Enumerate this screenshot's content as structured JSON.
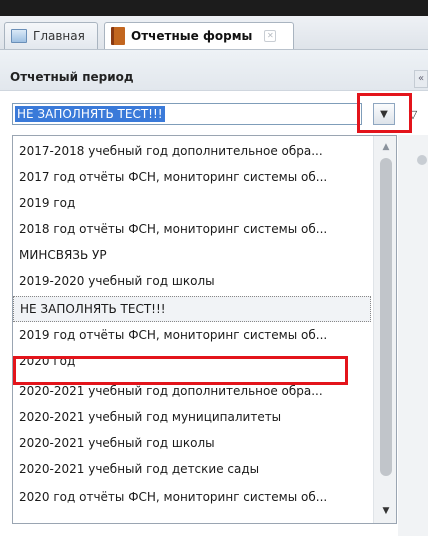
{
  "tabs": [
    {
      "label": "Главная",
      "icon": "home-icon"
    },
    {
      "label": "Отчетные формы",
      "icon": "book-icon",
      "close": "✕"
    }
  ],
  "panel": {
    "title": "Отчетный период",
    "collapse": "«"
  },
  "combo": {
    "value": "НЕ ЗАПОЛНЯТЬ ТЕСТ!!!",
    "trigger_glyph": "▼",
    "filter_glyph": "▽"
  },
  "dropdown": {
    "items": [
      "2017-2018 учебный год дополнительное обра...",
      "2017 год отчёты ФСН, мониторинг системы об...",
      "2019 год",
      "2018 год отчёты ФСН, мониторинг системы об...",
      "МИНСВЯЗЬ УР",
      "2019-2020 учебный год школы",
      "НЕ ЗАПОЛНЯТЬ ТЕСТ!!!",
      "2019 год отчёты ФСН, мониторинг системы об...",
      "2020 год",
      "2020-2021 учебный год дополнительное обра...",
      "2020-2021 учебный год муниципалитеты",
      "2020-2021 учебный год школы",
      "2020-2021 учебный год детские сады",
      "2020 год отчёты ФСН, мониторинг системы об..."
    ],
    "selected_index": 6,
    "highlighted_index": 8
  },
  "scroll": {
    "up": "▲",
    "down": "▼"
  },
  "colors": {
    "selection": "#3a7ad9",
    "highlight_box": "#e3141b"
  }
}
